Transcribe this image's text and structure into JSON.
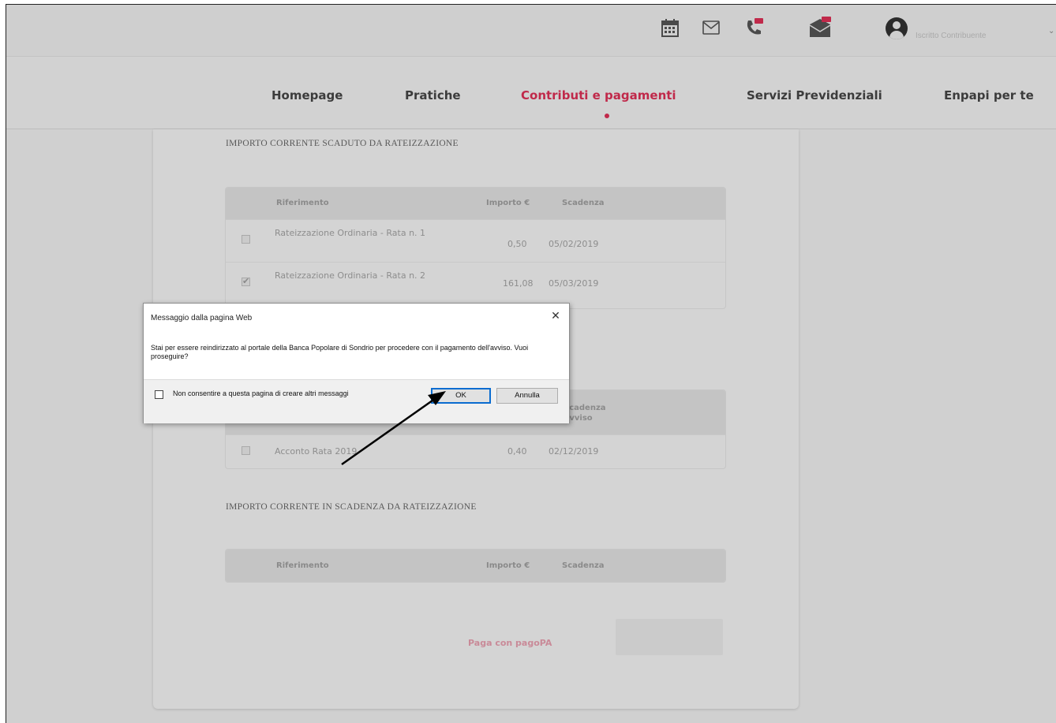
{
  "topbar": {
    "icons": [
      "calendar-icon",
      "mail-icon",
      "phone-icon",
      "pec-mail-icon"
    ],
    "user_label": "Iscritto Contribuente"
  },
  "nav": {
    "items": [
      {
        "label": "Homepage"
      },
      {
        "label": "Pratiche"
      },
      {
        "label": "Contributi e pagamenti"
      },
      {
        "label": "Servizi Previdenziali"
      },
      {
        "label": "Enpapi per te"
      }
    ]
  },
  "section1": {
    "title": "IMPORTO CORRENTE SCADUTO DA RATEIZZAZIONE",
    "headers": {
      "ref": "Riferimento",
      "amount": "Importo €",
      "due": "Scadenza"
    },
    "rows": [
      {
        "ref": "Rateizzazione Ordinaria - Rata n. 1",
        "amount": "0,50",
        "due": "05/02/2019",
        "checked": false
      },
      {
        "ref": "Rateizzazione Ordinaria - Rata n. 2",
        "amount": "161,08",
        "due": "05/03/2019",
        "checked": true
      }
    ]
  },
  "section2": {
    "headers": {
      "due": "Scadenza Avviso"
    },
    "rows": [
      {
        "ref": "Acconto Rata 2019",
        "amount": "0,40",
        "due": "02/12/2019",
        "checked": false
      }
    ]
  },
  "section3": {
    "title": "IMPORTO CORRENTE IN SCADENZA DA RATEIZZAZIONE",
    "headers": {
      "ref": "Riferimento",
      "amount": "Importo €",
      "due": "Scadenza"
    }
  },
  "pay": {
    "label": "Paga con pagoPA"
  },
  "dialog": {
    "title": "Messaggio dalla pagina Web",
    "message": "Stai per essere reindirizzato al portale della Banca Popolare di Sondrio per procedere con il pagamento dell'avviso. Vuoi proseguire?",
    "checkbox_label": "Non consentire a questa pagina di creare altri messaggi",
    "ok_label": "OK",
    "cancel_label": "Annulla"
  }
}
